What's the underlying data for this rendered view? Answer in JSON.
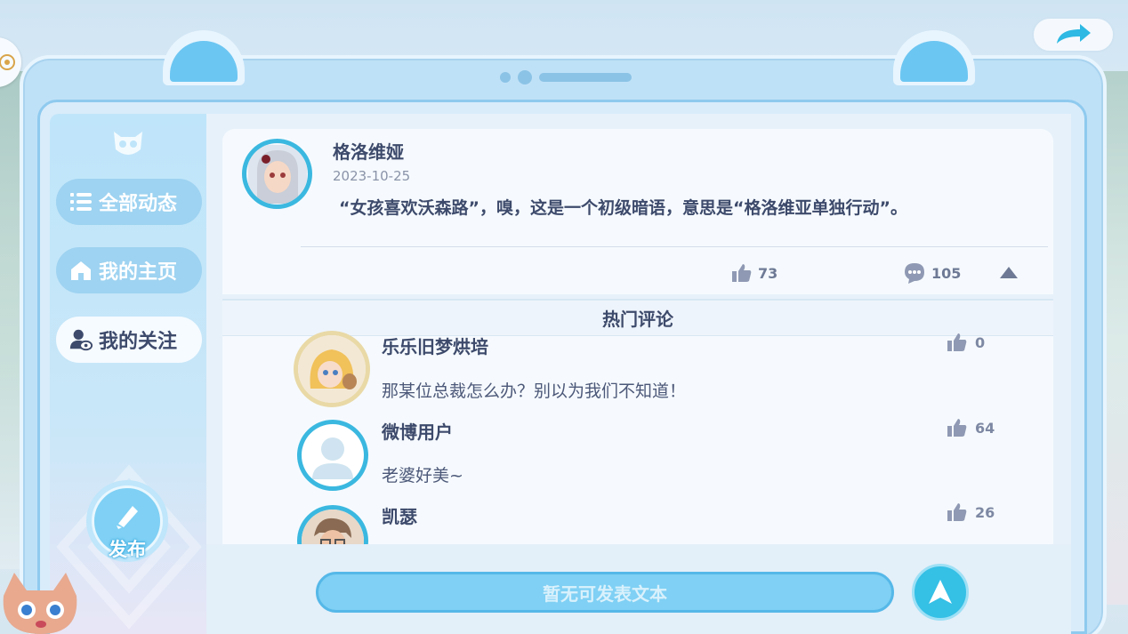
{
  "sidebar": {
    "items": [
      {
        "label": "全部动态",
        "icon": "list-icon",
        "active": false
      },
      {
        "label": "我的主页",
        "icon": "home-icon",
        "active": false
      },
      {
        "label": "我的关注",
        "icon": "follow-icon",
        "active": true
      }
    ],
    "publish_label": "发布"
  },
  "post": {
    "author": "格洛维娅",
    "date": "2023-10-25",
    "text": "“女孩喜欢沃森路”，嗅，这是一个初级暗语，意思是“格洛维亚单独行动”。",
    "likes": "73",
    "comments": "105"
  },
  "hot_comments": {
    "title": "热门评论",
    "items": [
      {
        "name": "乐乐旧梦烘培",
        "text": "那某位总裁怎么办？别以为我们不知道！",
        "likes": "0"
      },
      {
        "name": "微博用户",
        "text": "老婆好美~",
        "likes": "64"
      },
      {
        "name": "凯瑟",
        "text": "",
        "likes": "26"
      }
    ]
  },
  "composer": {
    "placeholder": "暂无可发表文本"
  },
  "colors": {
    "accent": "#35c0e6",
    "frame": "#bfe1f7",
    "text": "#3d4a6b"
  }
}
